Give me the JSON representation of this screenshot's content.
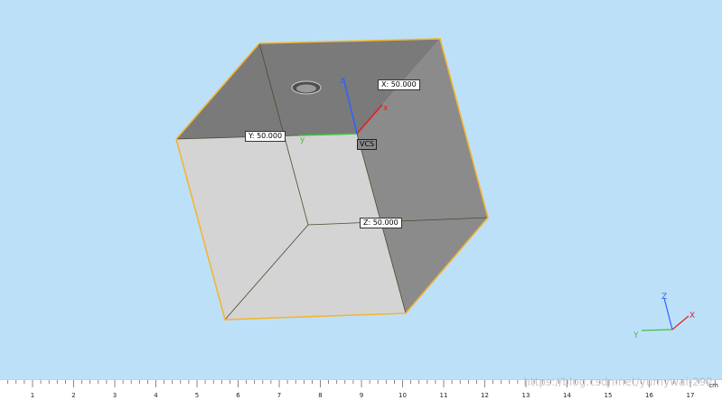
{
  "dimensions": {
    "x_label": "X: 50.000",
    "y_label": "Y: 50.000",
    "z_label": "Z: 50.000"
  },
  "local_axes": {
    "x": "x",
    "y": "y",
    "z": "z",
    "frame_label": "VCS"
  },
  "view_triad": {
    "x": "X",
    "y": "Y",
    "z": "Z"
  },
  "ruler": {
    "unit": "cm",
    "numbers": [
      "1",
      "2",
      "3",
      "4",
      "5",
      "6",
      "7",
      "8",
      "9",
      "10",
      "11",
      "12",
      "13",
      "14",
      "15",
      "16",
      "17"
    ]
  },
  "watermark": "https://blog.csdn.net/yumywai-292",
  "colors": {
    "background": "#bde0f9",
    "edge_highlight": "#f2b632",
    "axis_x": "#e02020",
    "axis_y": "#40c040",
    "axis_z": "#3060ff"
  }
}
